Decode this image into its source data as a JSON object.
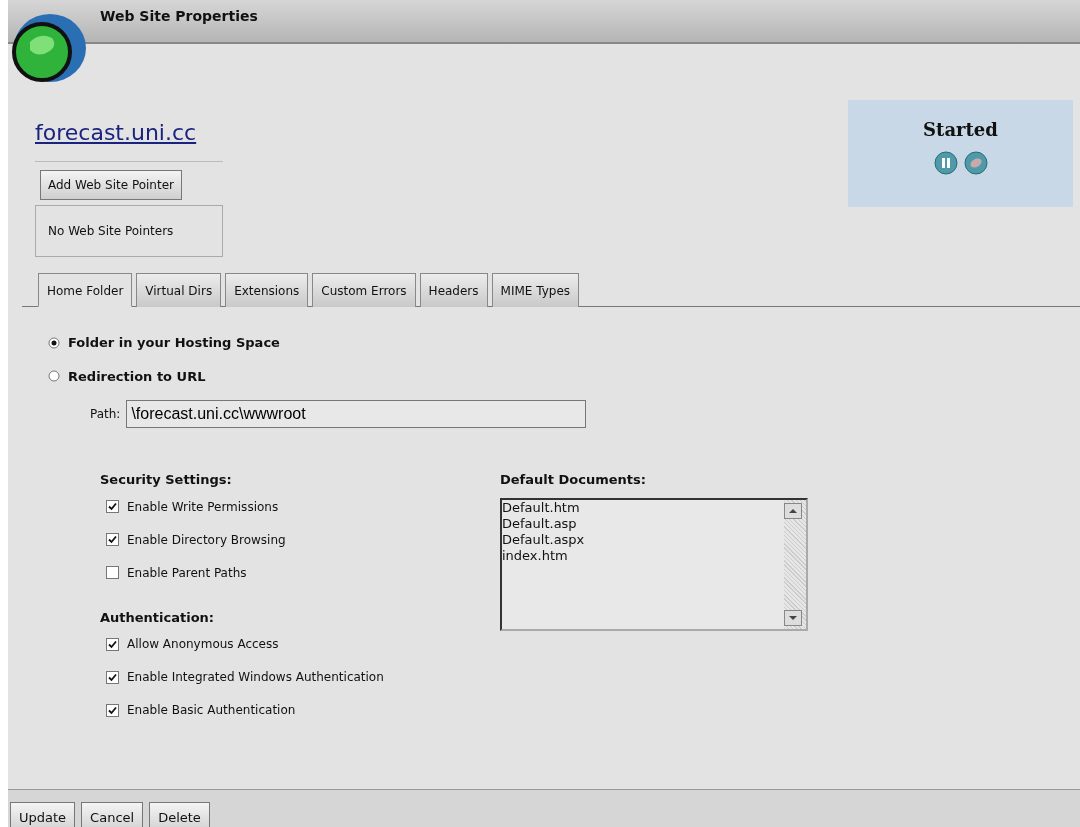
{
  "window": {
    "title": "Web Site Properties"
  },
  "site": {
    "name": "forecast.uni.cc"
  },
  "pointers": {
    "add_button": "Add Web Site Pointer",
    "empty_text": "No Web Site Pointers"
  },
  "status": {
    "label": "Started",
    "buttons": [
      {
        "kind": "pause"
      },
      {
        "kind": "stop"
      }
    ]
  },
  "tabs": [
    {
      "label": "Home Folder",
      "selected": true
    },
    {
      "label": "Virtual Dirs",
      "selected": false
    },
    {
      "label": "Extensions",
      "selected": false
    },
    {
      "label": "Custom Errors",
      "selected": false
    },
    {
      "label": "Headers",
      "selected": false
    },
    {
      "label": "MIME Types",
      "selected": false
    }
  ],
  "location_options": [
    {
      "label": "Folder in your Hosting Space",
      "selected": true
    },
    {
      "label": "Redirection to URL",
      "selected": false
    }
  ],
  "path": {
    "label": "Path:",
    "value": "\\forecast.uni.cc\\wwwroot"
  },
  "security": {
    "heading": "Security Settings:",
    "options": [
      {
        "label": "Enable Write Permissions",
        "checked": true
      },
      {
        "label": "Enable Directory Browsing",
        "checked": true
      },
      {
        "label": "Enable Parent Paths",
        "checked": false
      }
    ]
  },
  "authentication": {
    "heading": "Authentication:",
    "options": [
      {
        "label": "Allow Anonymous Access",
        "checked": true
      },
      {
        "label": "Enable Integrated Windows Authentication",
        "checked": true
      },
      {
        "label": "Enable Basic Authentication",
        "checked": true
      }
    ]
  },
  "default_documents": {
    "heading": "Default Documents:",
    "items": [
      "Default.htm",
      "Default.asp",
      "Default.aspx",
      "index.htm"
    ]
  },
  "footer_buttons": [
    "Update",
    "Cancel",
    "Delete"
  ]
}
